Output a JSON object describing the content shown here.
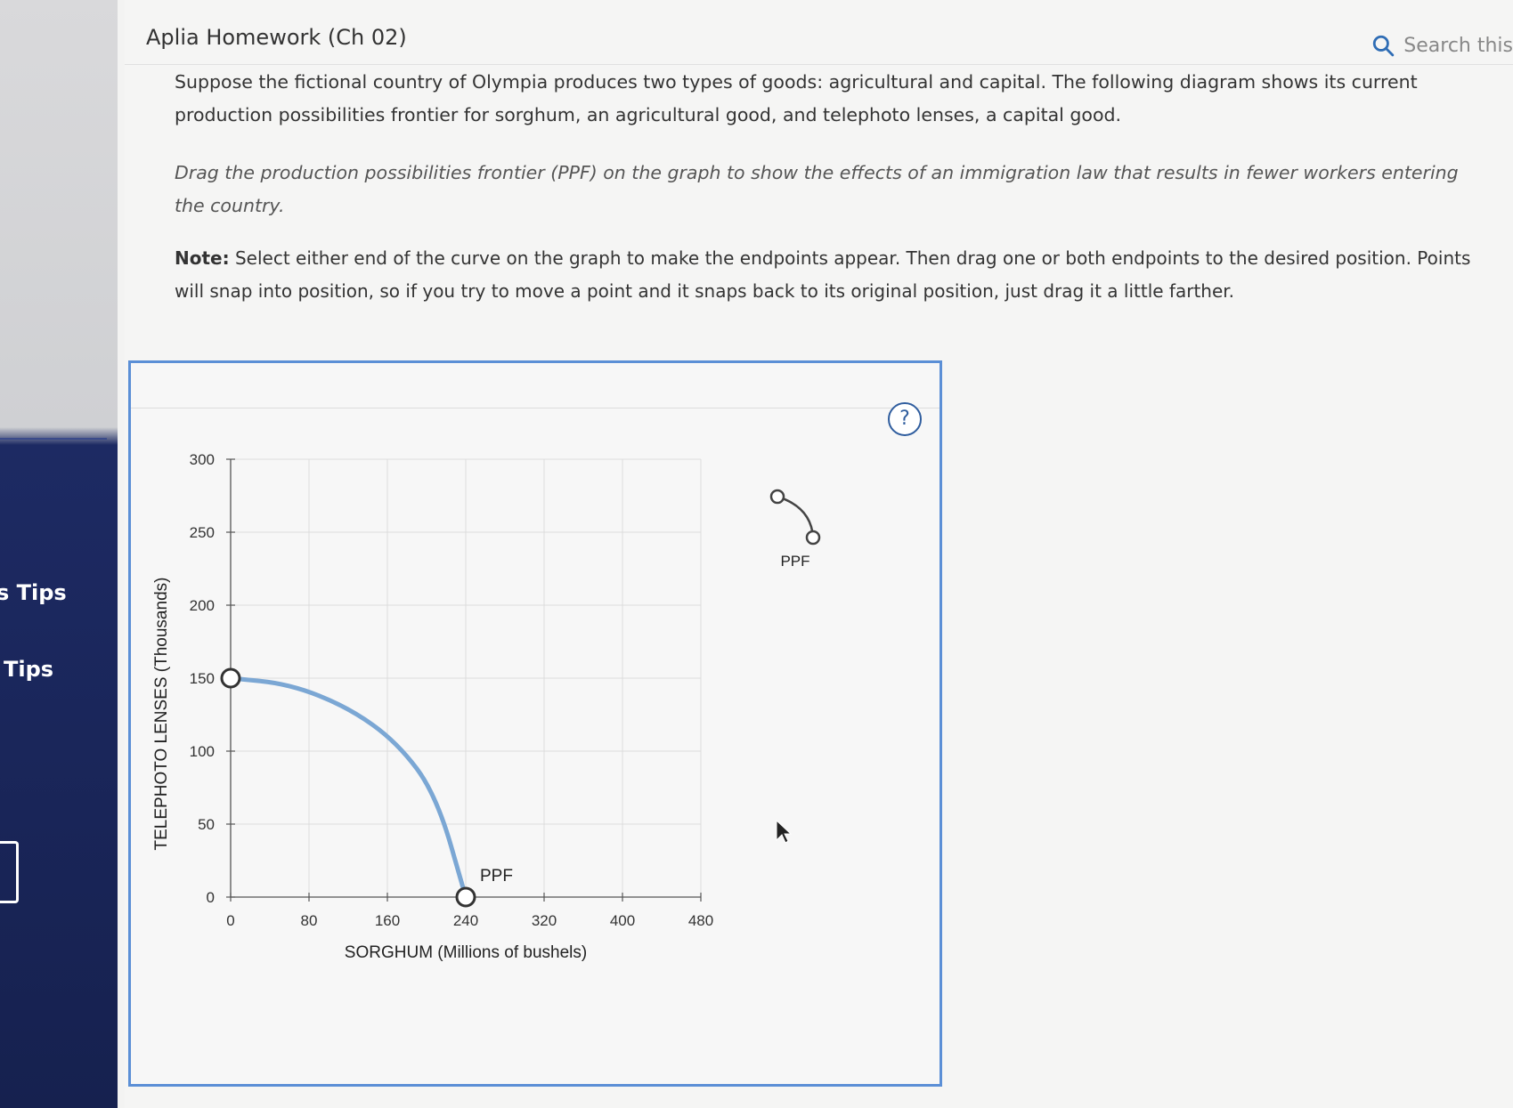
{
  "sidebar": {
    "items": [
      {
        "label": "s Tips"
      },
      {
        "label": "Tips"
      }
    ]
  },
  "header": {
    "title": "Aplia Homework (Ch 02)",
    "search_label": "Search this"
  },
  "content": {
    "intro": "Suppose the fictional country of Olympia produces two types of goods: agricultural and capital. The following diagram shows its current production possibilities frontier for sorghum, an agricultural good, and telephoto lenses, a capital good.",
    "instruction": "Drag the production possibilities frontier (PPF) on the graph to show the effects of an immigration law that results in fewer workers entering the country.",
    "note_label": "Note:",
    "note_text": " Select either end of the curve on the graph to make the endpoints appear. Then drag one or both endpoints to the desired position. Points will snap into position, so if you try to move a point and it snaps back to its original position, just drag it a little farther."
  },
  "graph": {
    "help_label": "?",
    "palette_label": "PPF",
    "curve_label": "PPF",
    "curve_color": "#7ba7d4"
  },
  "chart_data": {
    "type": "line",
    "xlabel": "SORGHUM (Millions of bushels)",
    "ylabel": "TELEPHOTO LENSES (Thousands)",
    "xlim": [
      0,
      480
    ],
    "ylim": [
      0,
      300
    ],
    "x_ticks": [
      0,
      80,
      160,
      240,
      320,
      400,
      480
    ],
    "y_ticks": [
      0,
      50,
      100,
      150,
      200,
      250,
      300
    ],
    "grid": true,
    "series": [
      {
        "name": "PPF",
        "x": [
          0,
          60,
          120,
          170,
          210,
          240
        ],
        "y": [
          150,
          146,
          130,
          106,
          70,
          0
        ]
      }
    ],
    "endpoints": [
      {
        "x": 0,
        "y": 150
      },
      {
        "x": 240,
        "y": 0
      }
    ]
  }
}
